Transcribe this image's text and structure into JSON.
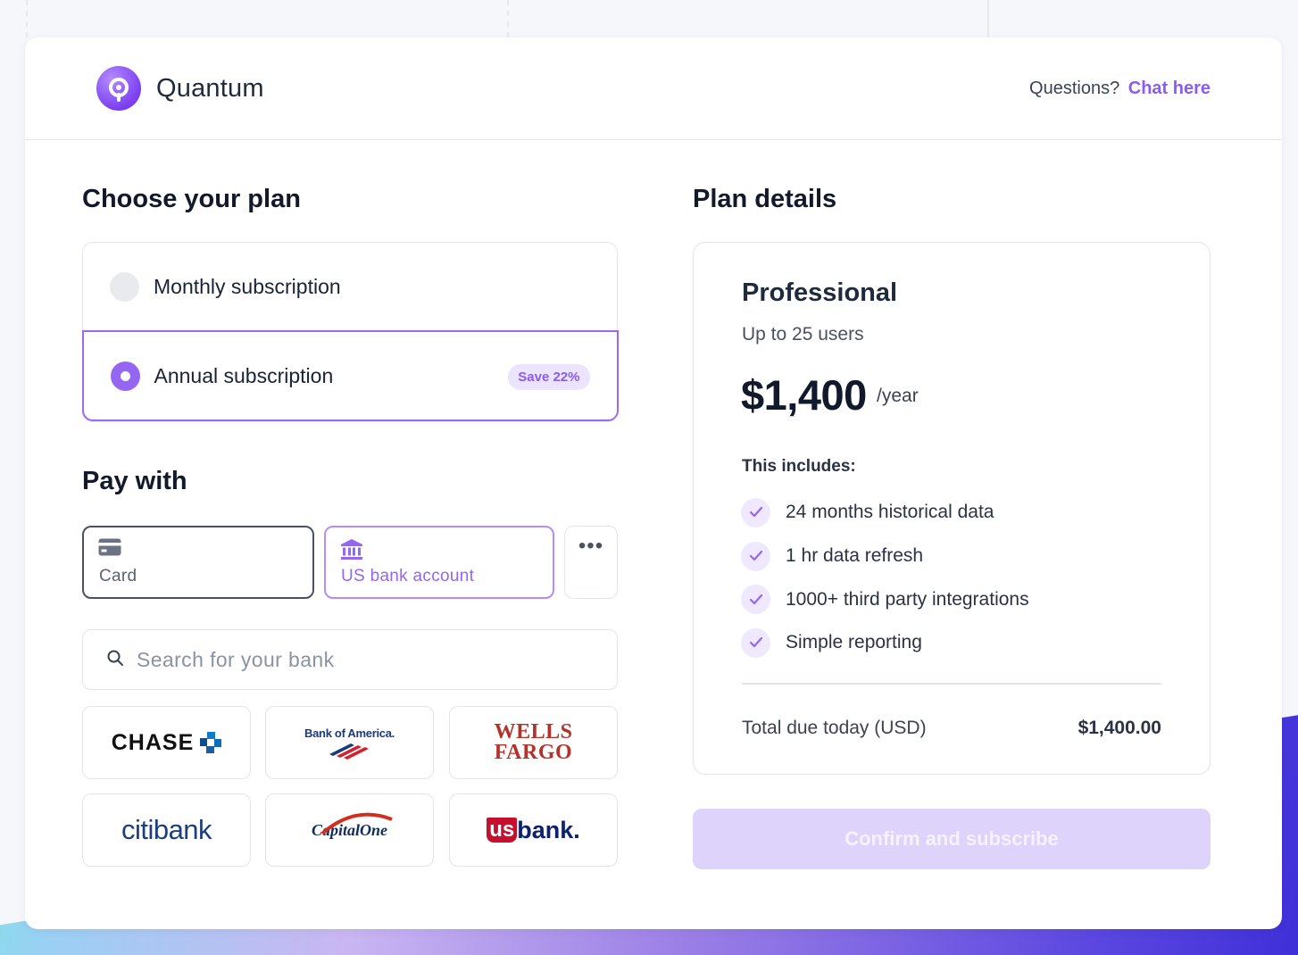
{
  "brand": {
    "name": "Quantum",
    "logo_icon": "q-logo-icon",
    "accent_color": "#8a5cf0"
  },
  "header": {
    "questions_text": "Questions?",
    "chat_link": "Chat here"
  },
  "plan_section": {
    "title": "Choose your plan",
    "options": [
      {
        "label": "Monthly subscription",
        "selected": false
      },
      {
        "label": "Annual subscription",
        "selected": true,
        "badge": "Save 22%"
      }
    ]
  },
  "pay_section": {
    "title": "Pay with",
    "methods": [
      {
        "label": "Card",
        "icon": "credit-card-icon",
        "selected": false
      },
      {
        "label": "US bank account",
        "icon": "bank-building-icon",
        "selected": true
      },
      {
        "label": "",
        "icon": "more-dots-icon",
        "selected": false
      }
    ],
    "search_placeholder": "Search for your bank",
    "banks": [
      "CHASE",
      "Bank of America.",
      "WELLS FARGO",
      "citibank",
      "CapitalOne",
      "usbank"
    ]
  },
  "details": {
    "title": "Plan details",
    "plan_name": "Professional",
    "plan_sub": "Up to 25 users",
    "price": "$1,400",
    "period": "/year",
    "includes_title": "This includes:",
    "features": [
      "24 months historical data",
      "1 hr data refresh",
      "1000+ third party integrations",
      "Simple reporting"
    ],
    "total_label": "Total due today (USD)",
    "total_value": "$1,400.00"
  },
  "confirm_button": "Confirm and subscribe"
}
